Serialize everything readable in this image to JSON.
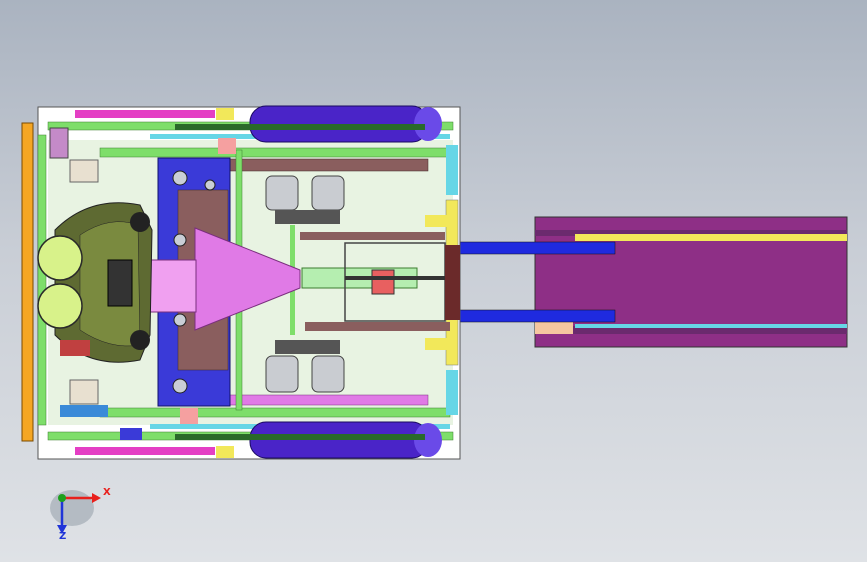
{
  "viewport": {
    "kind": "3d-cad-viewport",
    "view": "top"
  },
  "colors": {
    "background_top": "#aab3c0",
    "background_bottom": "#dfe2e6",
    "frame_white": "#ffffff",
    "rail_green": "#7ede6a",
    "rail_magenta": "#e43fc4",
    "rail_cyan": "#66d6e6",
    "beam_brown": "#8a5e5e",
    "plate_blue": "#3a3ad8",
    "plate_pink": "#e07ae6",
    "cylinder_purple": "#4a24c8",
    "tube_blue": "#1f2adf",
    "arm_purple": "#8e2f86",
    "bracket_orange": "#f5a623",
    "claw_olive": "#5e6a32",
    "wheel_lime": "#d8f28a",
    "motor_silver": "#c9ccd1",
    "plate_yellow": "#f2e85a",
    "axis_x": "#e8201c",
    "axis_y": "#1ca01c",
    "axis_z": "#2035d8"
  },
  "triad": {
    "x_label": "X",
    "z_label": "Z"
  }
}
